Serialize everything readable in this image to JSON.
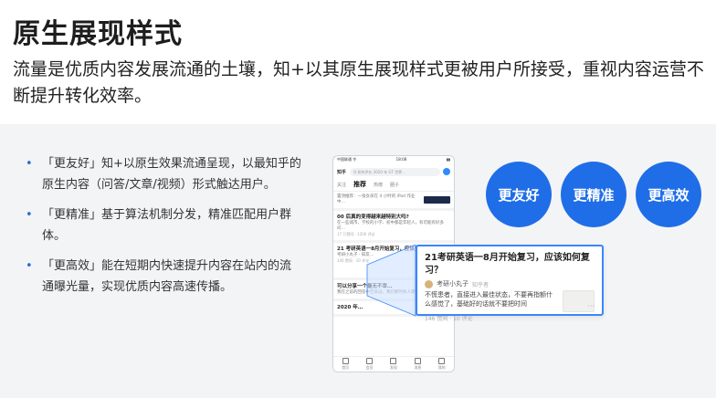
{
  "title": "原生展现样式",
  "subtitle": "流量是优质内容发展流通的土壤，知+以其原生展现样式更被用户所接受，重视内容运营不断提升转化效率。",
  "bullets": [
    {
      "text": "「更友好」知+以原生效果流通呈现，以最知乎的原生内容（问答/文章/视频）形式触达用户。"
    },
    {
      "text": "「更精准」基于算法机制分发，精准匹配用户群体。"
    },
    {
      "text": "「更高效」能在短期内快速提升内容在站内的流通曝光量，实现优质内容高速传播。"
    }
  ],
  "phone": {
    "status_left": "中国联通 令",
    "status_time": "18:08",
    "status_right": "▮▮",
    "logo": "知乎",
    "search_placeholder": "Q 如何评价 2020 年 GT 世界...",
    "tabs": [
      "关注",
      "推荐",
      "热榜",
      "圈子"
    ],
    "active_tab": 1,
    "cards": [
      {
        "q": "",
        "a": "置顶推荐：一张女孩在 4 小时的 iPad 作业中…",
        "m": "",
        "ad": true
      },
      {
        "q": "00 后真的变得越来越特别大吗?",
        "a": "在一些城市，学校的小学、初中都是年轻人，有可能有好多问…",
        "m": "17 万赞同 · 1200 评论"
      },
      {
        "q": "21 考研英语一8月开始复习，应该如何复习？",
        "a": "考研小丸子 · 知友…",
        "m": "146 赞同 · 10 评论",
        "slot": true
      },
      {
        "q": "可以分享一个最无不幸…",
        "a": "我在之前的回答中告诉过，我们那时有人需要…",
        "m": "",
        "slot": false
      },
      {
        "q": "2020 年…",
        "a": "",
        "m": ""
      }
    ],
    "nav": [
      "首页",
      "会员",
      "发现",
      "消息",
      "我的"
    ]
  },
  "popup": {
    "question": "21考研英语一8月开始复习，应该如何复习？",
    "author": "考研小丸子",
    "author_tag": "知乎者",
    "body": "不慌患者，直接进入最佳状态，不要再指额什么感觉了，基础好的话就不要把时间",
    "meta": "146 赞同 · 10 评论",
    "more": "···"
  },
  "circles": [
    {
      "label": "更友好"
    },
    {
      "label": "更精准"
    },
    {
      "label": "更高效"
    }
  ],
  "colors": {
    "accent": "#1f6ee8",
    "band": "#f3f4f6"
  }
}
